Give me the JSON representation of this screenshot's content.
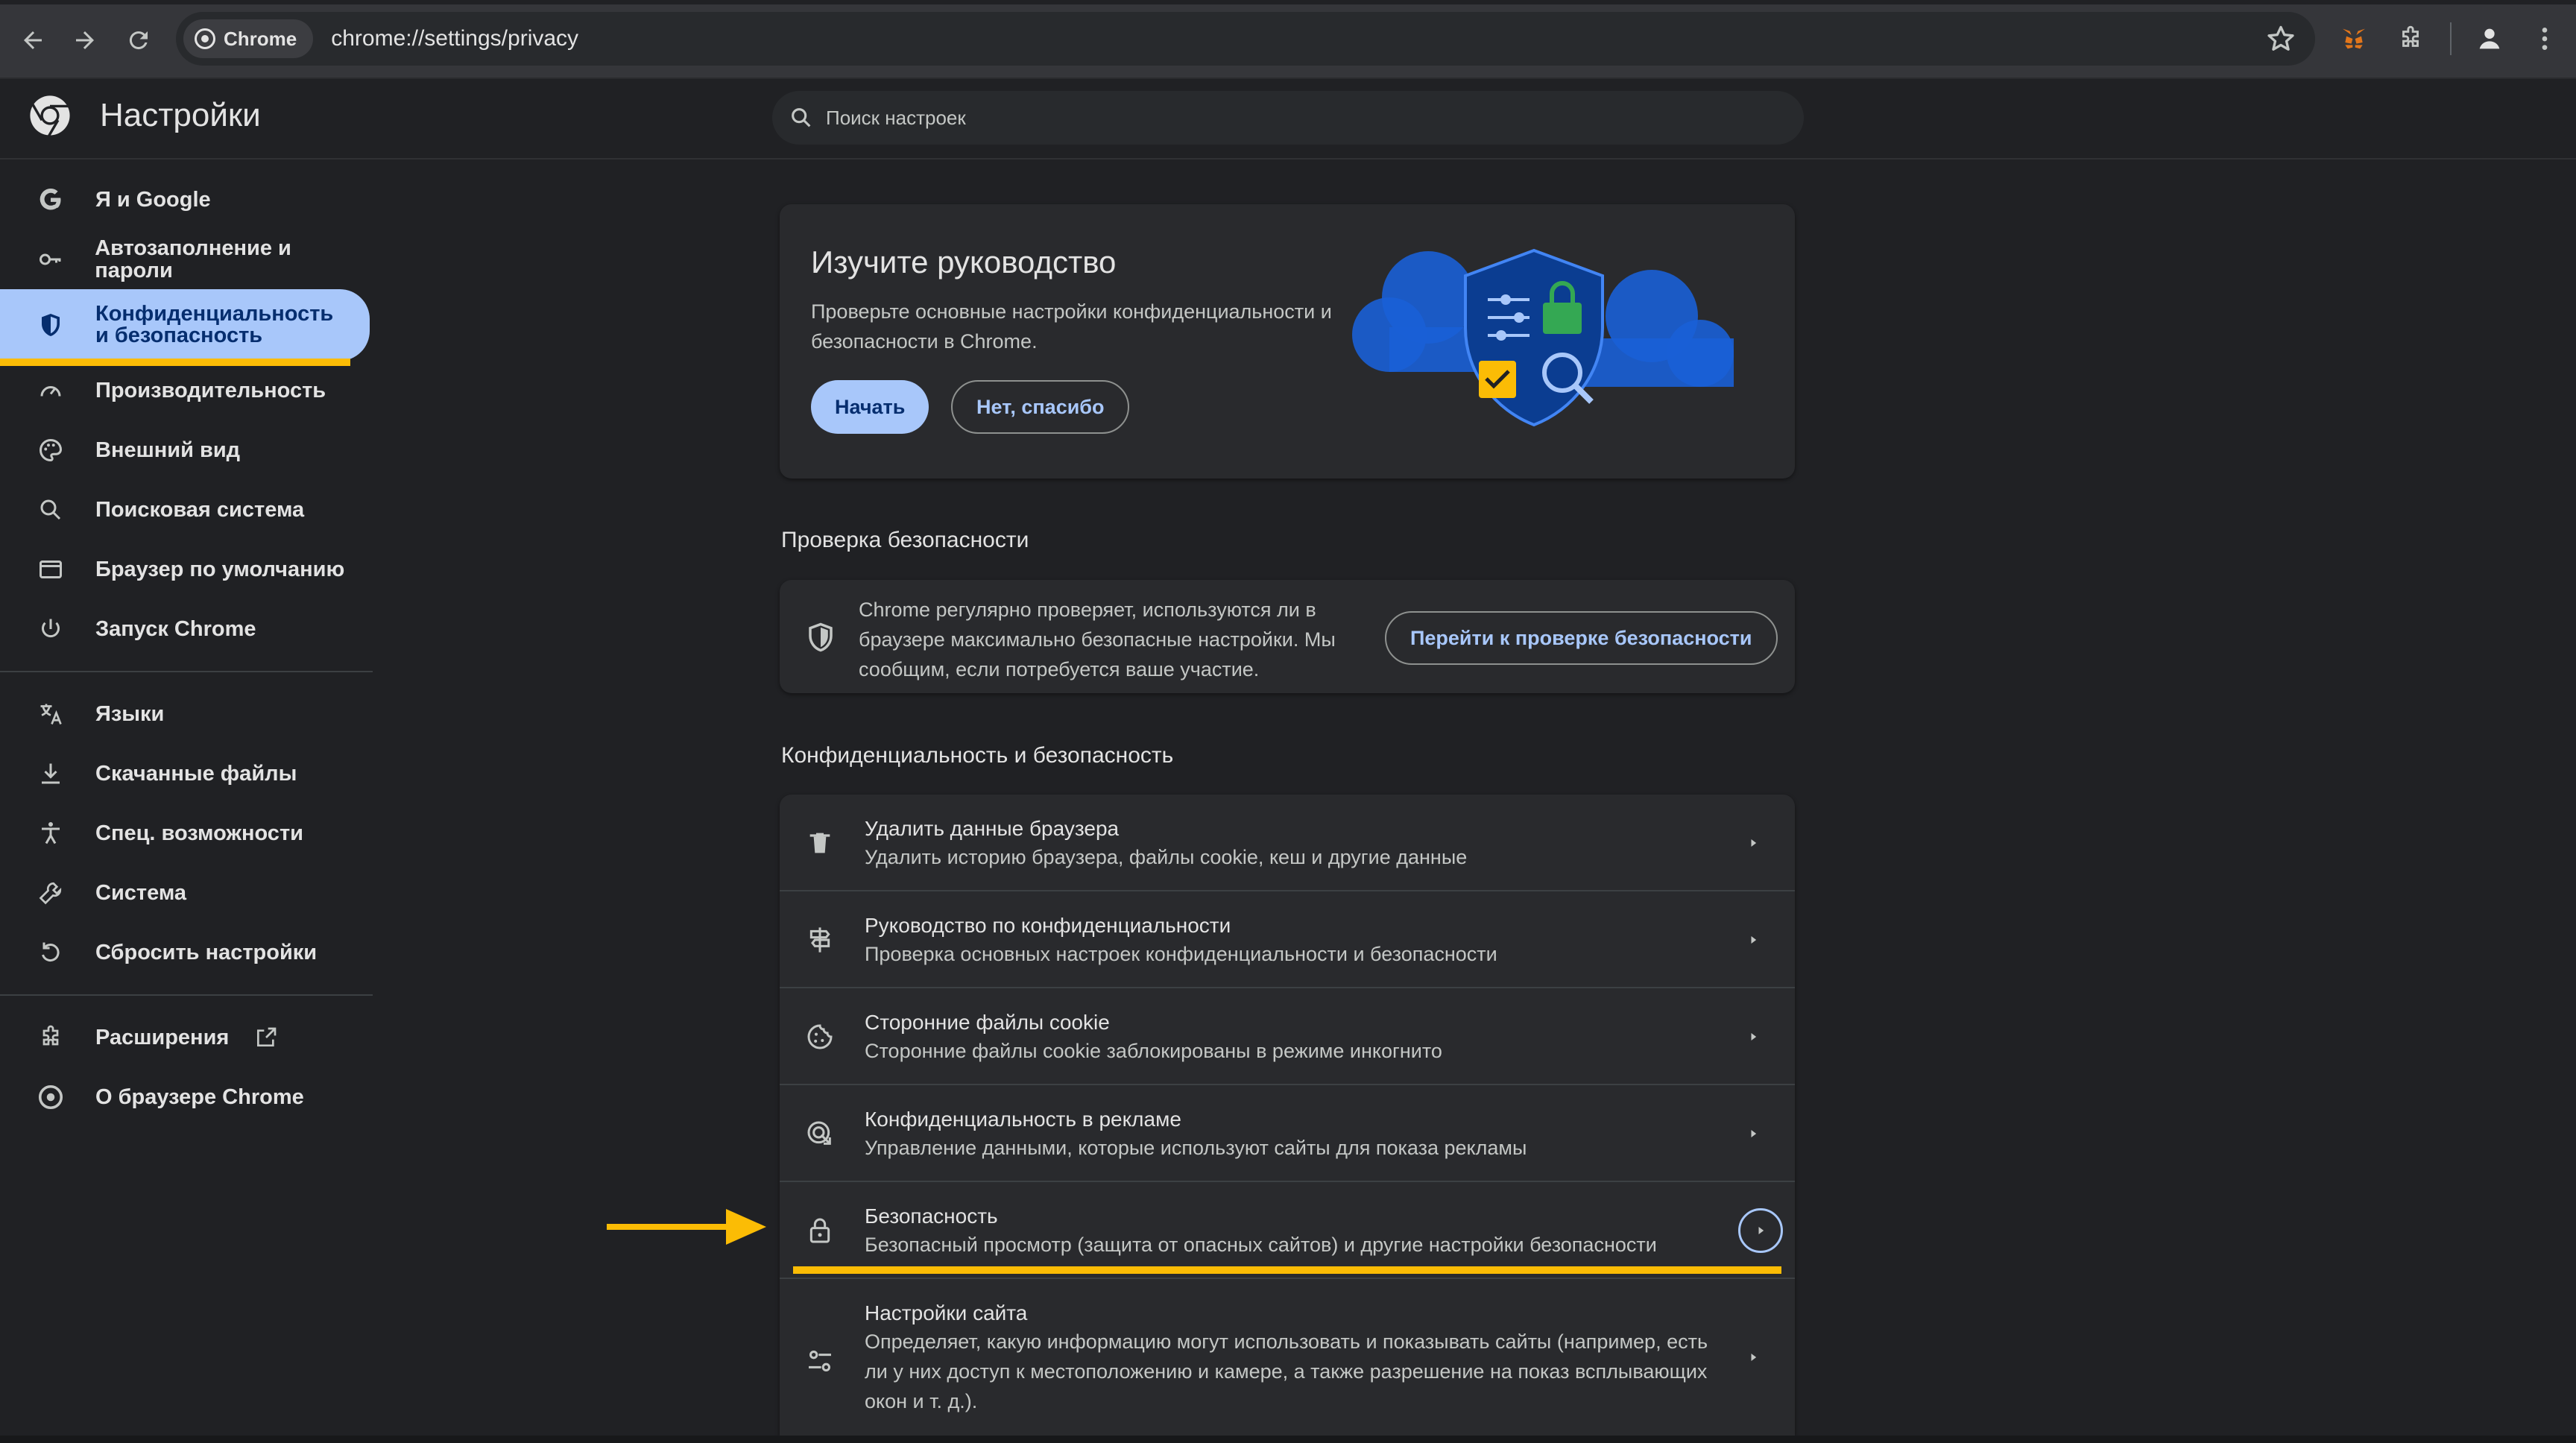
{
  "browser": {
    "site_chip": "Chrome",
    "url": "chrome://settings/privacy"
  },
  "header": {
    "title": "Настройки",
    "search_placeholder": "Поиск настроек"
  },
  "sidebar": {
    "items": [
      {
        "label": "Я и Google",
        "icon": "google-icon"
      },
      {
        "label": "Автозаполнение и пароли",
        "icon": "key-icon"
      },
      {
        "label": "Конфиденциальность и безопасность",
        "icon": "shield-icon",
        "active": true
      },
      {
        "label": "Производительность",
        "icon": "speedometer-icon"
      },
      {
        "label": "Внешний вид",
        "icon": "palette-icon"
      },
      {
        "label": "Поисковая система",
        "icon": "search-icon"
      },
      {
        "label": "Браузер по умолчанию",
        "icon": "browser-window-icon"
      },
      {
        "label": "Запуск Chrome",
        "icon": "power-icon"
      },
      {
        "label": "Языки",
        "icon": "translate-icon"
      },
      {
        "label": "Скачанные файлы",
        "icon": "download-icon"
      },
      {
        "label": "Спец. возможности",
        "icon": "accessibility-icon"
      },
      {
        "label": "Система",
        "icon": "wrench-icon"
      },
      {
        "label": "Сбросить настройки",
        "icon": "reset-icon"
      },
      {
        "label": "Расширения",
        "icon": "puzzle-icon"
      },
      {
        "label": "О браузере Chrome",
        "icon": "chrome-logo-icon"
      }
    ]
  },
  "promo": {
    "title": "Изучите руководство",
    "text": "Проверьте основные настройки конфиденциальности и безопасности в Chrome.",
    "start_label": "Начать",
    "dismiss_label": "Нет, спасибо"
  },
  "safety_check": {
    "section_title": "Проверка безопасности",
    "text": "Chrome регулярно проверяет, используются ли в браузере максимально безопасные настройки. Мы сообщим, если потребуется ваше участие.",
    "button_label": "Перейти к проверке безопасности"
  },
  "privacy": {
    "section_title": "Конфиденциальность и безопасность",
    "rows": [
      {
        "title": "Удалить данные браузера",
        "subtitle": "Удалить историю браузера, файлы cookie, кеш и другие данные",
        "icon": "trash-icon"
      },
      {
        "title": "Руководство по конфиденциальности",
        "subtitle": "Проверка основных настроек конфиденциальности и безопасности",
        "icon": "signpost-icon"
      },
      {
        "title": "Сторонние файлы cookie",
        "subtitle": "Сторонние файлы cookie заблокированы в режиме инкогнито",
        "icon": "cookie-icon"
      },
      {
        "title": "Конфиденциальность в рекламе",
        "subtitle": "Управление данными, которые используют сайты для показа рекламы",
        "icon": "ads-privacy-icon"
      },
      {
        "title": "Безопасность",
        "subtitle": "Безопасный просмотр (защита от опасных сайтов) и другие настройки безопасности",
        "icon": "lock-icon"
      },
      {
        "title": "Настройки сайта",
        "subtitle": "Определяет, какую информацию могут использовать и показывать сайты (например, есть ли у них доступ к местоположению и камере, а также разрешение на показ всплывающих окон и т. д.).",
        "icon": "tune-icon"
      }
    ]
  },
  "colors": {
    "background": "#202124",
    "card": "#292a2d",
    "accent": "#a8c7fa",
    "highlight": "#fbbc05"
  }
}
